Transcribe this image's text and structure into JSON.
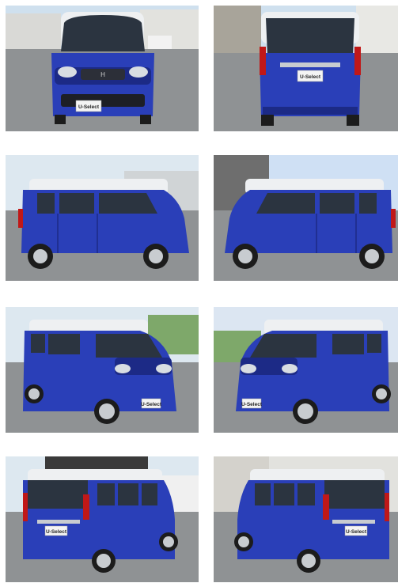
{
  "gallery": {
    "photos": [
      {
        "view": "front",
        "plate": "U-Select"
      },
      {
        "view": "rear",
        "plate": "U-Select"
      },
      {
        "view": "left-side",
        "plate": ""
      },
      {
        "view": "right-side",
        "plate": ""
      },
      {
        "view": "front-left",
        "plate": "U-Select"
      },
      {
        "view": "front-right",
        "plate": "U-Select"
      },
      {
        "view": "rear-left",
        "plate": "U-Select"
      },
      {
        "view": "rear-right",
        "plate": "U-Select"
      }
    ],
    "colors": {
      "body_blue": "#2a3fb8",
      "body_blue_dark": "#1c2a86",
      "roof_white": "#eef0f2",
      "glass": "#2b3440",
      "asphalt": "#8f9294",
      "sky": "#cfe0ee",
      "tire": "#1c1c1c",
      "wheel": "#c8ccd0"
    }
  }
}
